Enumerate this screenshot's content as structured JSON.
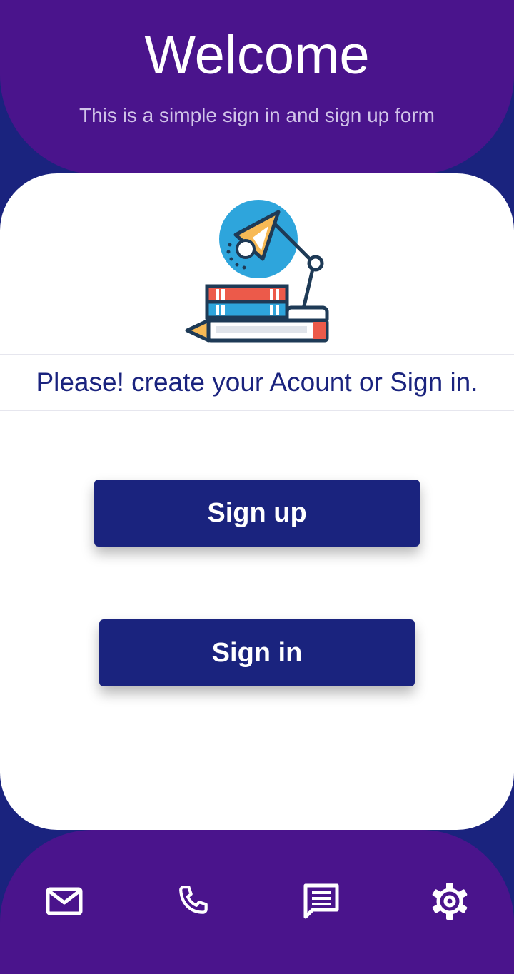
{
  "header": {
    "title": "Welcome",
    "subtitle": "This is a simple sign in and sign up form"
  },
  "card": {
    "illustration": "desk-lamp-books-pencil-illustration",
    "prompt": "Please! create your Acount or Sign in.",
    "signup_label": "Sign up",
    "signin_label": "Sign in"
  },
  "footer": {
    "icons": [
      "mail-icon",
      "phone-icon",
      "chat-icon",
      "settings-icon"
    ]
  },
  "colors": {
    "primary": "#1a237e",
    "header_purple": "#4a148c",
    "card_bg": "#ffffff",
    "subtitle_text": "#d1c4e9"
  }
}
